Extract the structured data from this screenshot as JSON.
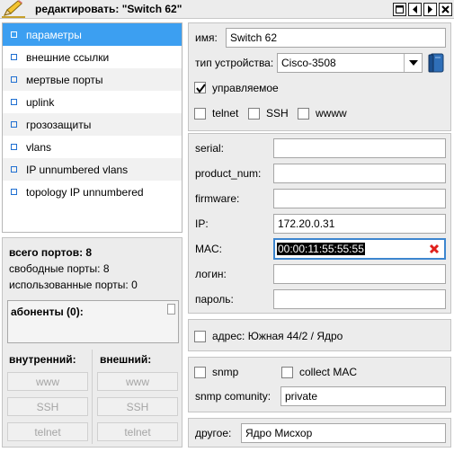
{
  "window": {
    "title": "редактировать: \"Switch 62\"",
    "icons": [
      "pencil-icon",
      "maximize-icon",
      "prev-icon",
      "next-icon",
      "close-icon"
    ]
  },
  "menu": {
    "items": [
      {
        "label": "параметры",
        "selected": true
      },
      {
        "label": "внешние ссылки"
      },
      {
        "label": "мертвые порты"
      },
      {
        "label": "uplink"
      },
      {
        "label": "грозозащиты"
      },
      {
        "label": "vlans"
      },
      {
        "label": "IP unnumbered vlans"
      },
      {
        "label": "topology IP unnumbered"
      }
    ]
  },
  "stats": {
    "total_ports": "всего портов: 8",
    "free_ports": "свободные порты: 8",
    "used_ports": "использованные порты: 0",
    "subscribers": "абоненты (0):",
    "internal_label": "внутренний:",
    "external_label": "внешний:",
    "internal_buttons": [
      "www",
      "SSH",
      "telnet"
    ],
    "external_buttons": [
      "www",
      "SSH",
      "telnet"
    ]
  },
  "form": {
    "name_label": "имя:",
    "name_value": "Switch 62",
    "device_type_label": "тип устройства:",
    "device_type_value": "Cisco-3508",
    "managed_label": "управляемое",
    "managed_checked": true,
    "telnet_label": "telnet",
    "ssh_label": "SSH",
    "www_label": "wwww",
    "serial_label": "serial:",
    "serial_value": "",
    "product_num_label": "product_num:",
    "product_num_value": "",
    "firmware_label": "firmware:",
    "firmware_value": "",
    "ip_label": "IP:",
    "ip_value": "172.20.0.31",
    "mac_label": "MAC:",
    "mac_value": "00:00:11:55:55:55",
    "login_label": "логин:",
    "login_value": "",
    "password_label": "пароль:",
    "password_value": "",
    "address_label": "адрес: Южная 44/2  / Ядро",
    "snmp_label": "snmp",
    "collect_mac_label": "collect MAC",
    "snmp_community_label": "snmp comunity:",
    "snmp_community_value": "private",
    "other_label": "другое:",
    "other_value": "Ядро Мисхор"
  },
  "colors": {
    "accent": "#3c9ff1",
    "panel": "#ececec",
    "clear": "#e0201b"
  }
}
